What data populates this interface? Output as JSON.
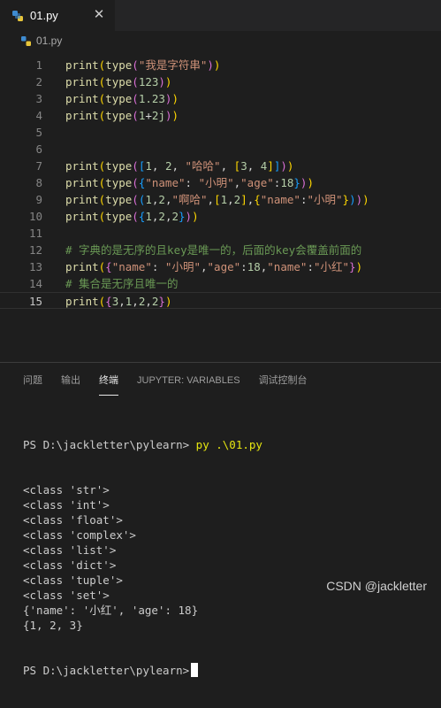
{
  "tab": {
    "label": "01.py",
    "close": "✕"
  },
  "breadcrumb": {
    "file": "01.py"
  },
  "editor": {
    "current_line": "15",
    "lines": [
      {
        "no": "1",
        "text": "print(type(\"我是字符串\"))"
      },
      {
        "no": "2",
        "text": "print(type(123))"
      },
      {
        "no": "3",
        "text": "print(type(1.23))"
      },
      {
        "no": "4",
        "text": "print(type(1+2j))"
      },
      {
        "no": "5",
        "text": ""
      },
      {
        "no": "6",
        "text": ""
      },
      {
        "no": "7",
        "text": "print(type([1, 2, \"哈哈\", [3, 4]]))"
      },
      {
        "no": "8",
        "text": "print(type({\"name\": \"小明\",\"age\":18}))"
      },
      {
        "no": "9",
        "text": "print(type((1,2,\"啊哈\",[1,2],{\"name\":\"小明\"})))"
      },
      {
        "no": "10",
        "text": "print(type({1,2,2}))"
      },
      {
        "no": "11",
        "text": ""
      },
      {
        "no": "12",
        "text": "# 字典的是无序的且key是唯一的，后面的key会覆盖前面的"
      },
      {
        "no": "13",
        "text": "print({\"name\": \"小明\",\"age\":18,\"name\":\"小红\"})"
      },
      {
        "no": "14",
        "text": "# 集合是无序且唯一的"
      },
      {
        "no": "15",
        "text": "print({3,1,2,2})"
      }
    ]
  },
  "panel": {
    "tabs": [
      "问题",
      "输出",
      "终端",
      "JUPYTER: VARIABLES",
      "调试控制台"
    ],
    "active_tab": "终端"
  },
  "terminal": {
    "prompt": "PS D:\\jackletter\\pylearn> ",
    "command": "py .\\01.py",
    "output": [
      "<class 'str'>",
      "<class 'int'>",
      "<class 'float'>",
      "<class 'complex'>",
      "<class 'list'>",
      "<class 'dict'>",
      "<class 'tuple'>",
      "<class 'set'>",
      "{'name': '小红', 'age': 18}",
      "{1, 2, 3}"
    ],
    "final_prompt": "PS D:\\jackletter\\pylearn>"
  },
  "watermark": "CSDN @jackletter",
  "colors": {
    "function": "#dcdcaa",
    "string": "#ce9178",
    "number": "#b5cea8",
    "comment": "#6a9955",
    "bracket1": "#ffd700",
    "bracket2": "#da70d6",
    "bracket3": "#179fff",
    "prompt_cmd": "#e5e510"
  }
}
